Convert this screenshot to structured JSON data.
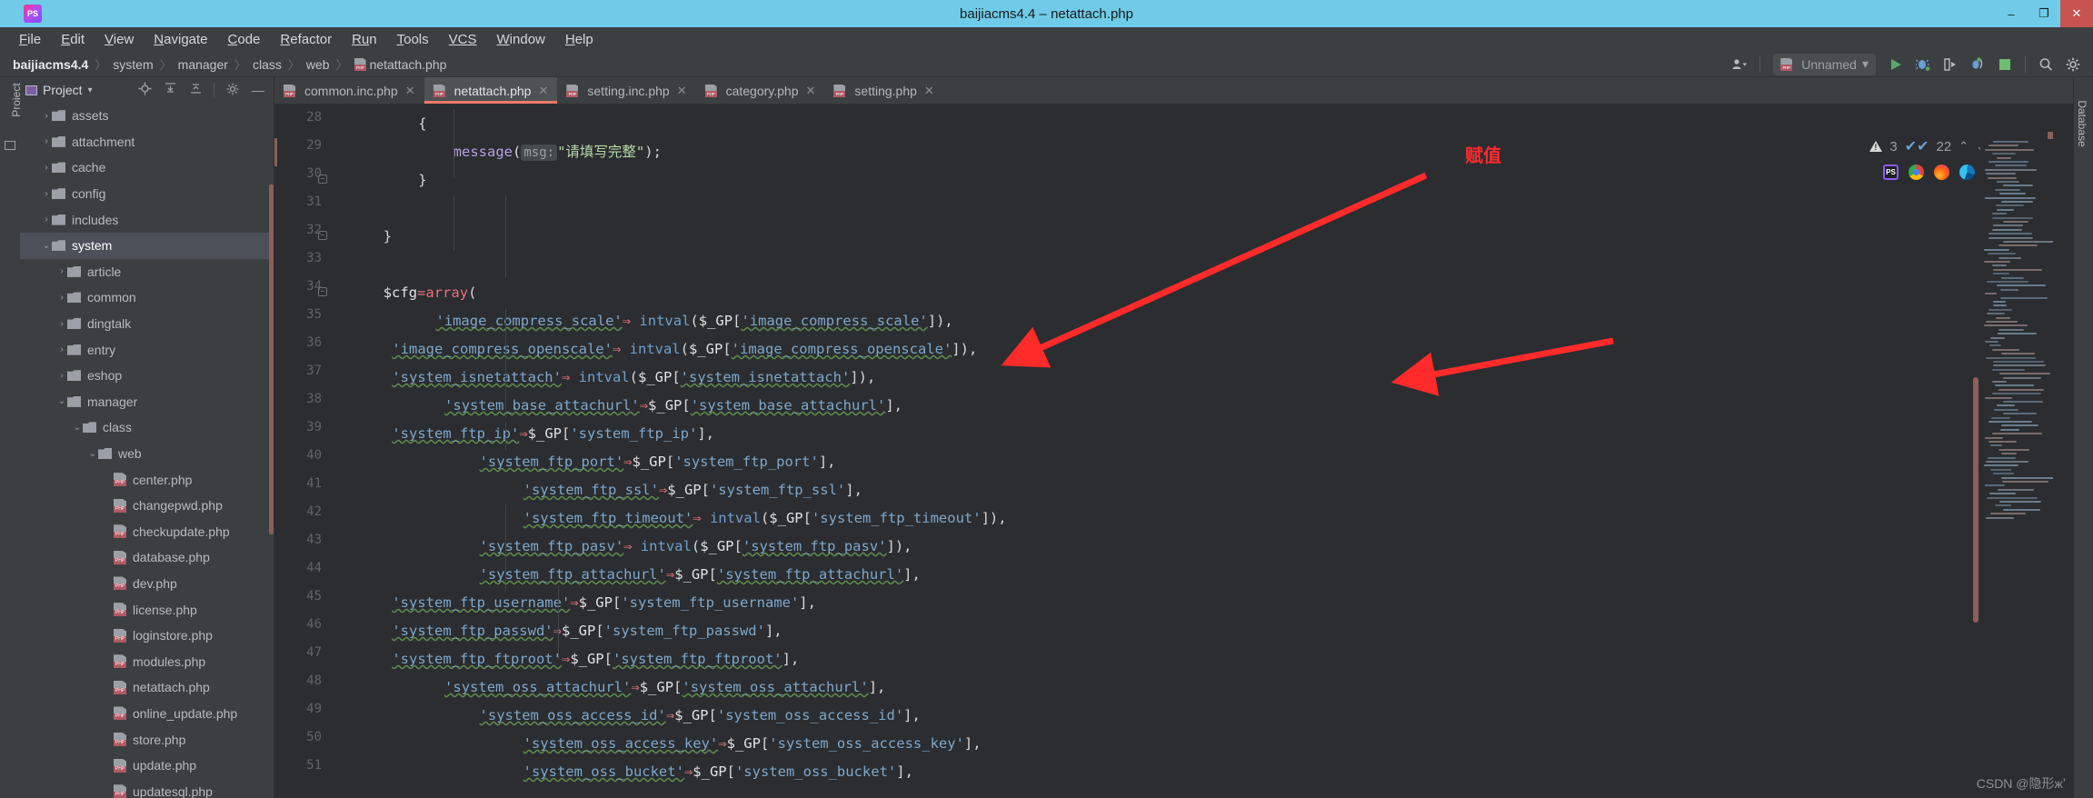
{
  "window": {
    "title": "baijiacms4.4 – netattach.php",
    "minimize": "–",
    "maximize": "❐",
    "close": "✕"
  },
  "menubar": {
    "items": [
      {
        "mnemonic": "F",
        "rest": "ile"
      },
      {
        "mnemonic": "E",
        "rest": "dit"
      },
      {
        "mnemonic": "V",
        "rest": "iew"
      },
      {
        "mnemonic": "N",
        "rest": "avigate"
      },
      {
        "mnemonic": "C",
        "rest": "ode"
      },
      {
        "mnemonic": "R",
        "rest": "efactor"
      },
      {
        "mnemonic": "Ru",
        "rest": "n"
      },
      {
        "mnemonic": "T",
        "rest": "ools"
      },
      {
        "mnemonic": "VCS",
        "rest": ""
      },
      {
        "mnemonic": "W",
        "rest": "indow"
      },
      {
        "mnemonic": "H",
        "rest": "elp"
      }
    ]
  },
  "breadcrumb": {
    "project": "baijiacms4.4",
    "separator": "〉",
    "path": [
      "system",
      "manager",
      "class",
      "web"
    ],
    "file": "netattach.php",
    "file_icon": "php-file-icon"
  },
  "toolbar": {
    "avatar_icon": "user-accounts-icon",
    "avatar_caret": "▾",
    "run_config": "Unnamed",
    "run_config_caret": "▾",
    "run_icon": "run-play-icon",
    "debug_icon": "debug-bug-icon",
    "run_coverage_icon": "run-with-coverage-icon",
    "profile_icon": "profile-icon",
    "stop_icon": "stop-square-icon",
    "search_icon": "search-icon",
    "settings_icon": "settings-gear-icon"
  },
  "left_strip": {
    "project_tab": "Project",
    "structure_icon": "project-panel-icon"
  },
  "right_strip": {
    "database_tab": "Database"
  },
  "project_panel": {
    "title": "Project",
    "caret": "▾",
    "icons": [
      "locate-icon",
      "expand-all-icon",
      "collapse-all-icon",
      "settings-gear-icon",
      "hide-icon"
    ],
    "tree": [
      {
        "label": "assets",
        "depth": 1,
        "type": "folder",
        "arrow": "›",
        "selected": false
      },
      {
        "label": "attachment",
        "depth": 1,
        "type": "folder",
        "arrow": "›",
        "selected": false
      },
      {
        "label": "cache",
        "depth": 1,
        "type": "folder",
        "arrow": "›",
        "selected": false
      },
      {
        "label": "config",
        "depth": 1,
        "type": "folder",
        "arrow": "›",
        "selected": false
      },
      {
        "label": "includes",
        "depth": 1,
        "type": "folder",
        "arrow": "›",
        "selected": false
      },
      {
        "label": "system",
        "depth": 1,
        "type": "folder",
        "arrow": "⌄",
        "selected": true
      },
      {
        "label": "article",
        "depth": 2,
        "type": "folder",
        "arrow": "›",
        "selected": false
      },
      {
        "label": "common",
        "depth": 2,
        "type": "folder",
        "arrow": "›",
        "selected": false
      },
      {
        "label": "dingtalk",
        "depth": 2,
        "type": "folder",
        "arrow": "›",
        "selected": false
      },
      {
        "label": "entry",
        "depth": 2,
        "type": "folder",
        "arrow": "›",
        "selected": false
      },
      {
        "label": "eshop",
        "depth": 2,
        "type": "folder",
        "arrow": "›",
        "selected": false
      },
      {
        "label": "manager",
        "depth": 2,
        "type": "folder",
        "arrow": "⌄",
        "selected": false
      },
      {
        "label": "class",
        "depth": 3,
        "type": "folder",
        "arrow": "⌄",
        "selected": false
      },
      {
        "label": "web",
        "depth": 4,
        "type": "folder",
        "arrow": "⌄",
        "selected": false
      },
      {
        "label": "center.php",
        "depth": 5,
        "type": "php",
        "arrow": "",
        "selected": false
      },
      {
        "label": "changepwd.php",
        "depth": 5,
        "type": "php",
        "arrow": "",
        "selected": false
      },
      {
        "label": "checkupdate.php",
        "depth": 5,
        "type": "php",
        "arrow": "",
        "selected": false
      },
      {
        "label": "database.php",
        "depth": 5,
        "type": "php",
        "arrow": "",
        "selected": false
      },
      {
        "label": "dev.php",
        "depth": 5,
        "type": "php",
        "arrow": "",
        "selected": false
      },
      {
        "label": "license.php",
        "depth": 5,
        "type": "php",
        "arrow": "",
        "selected": false
      },
      {
        "label": "loginstore.php",
        "depth": 5,
        "type": "php",
        "arrow": "",
        "selected": false
      },
      {
        "label": "modules.php",
        "depth": 5,
        "type": "php",
        "arrow": "",
        "selected": false
      },
      {
        "label": "netattach.php",
        "depth": 5,
        "type": "php",
        "arrow": "",
        "selected": false
      },
      {
        "label": "online_update.php",
        "depth": 5,
        "type": "php",
        "arrow": "",
        "selected": false
      },
      {
        "label": "store.php",
        "depth": 5,
        "type": "php",
        "arrow": "",
        "selected": false
      },
      {
        "label": "update.php",
        "depth": 5,
        "type": "php",
        "arrow": "",
        "selected": false
      },
      {
        "label": "updatesql.php",
        "depth": 5,
        "type": "php",
        "arrow": "",
        "selected": false
      }
    ]
  },
  "editor_tabs": [
    {
      "label": "common.inc.php",
      "active": false,
      "close": "✕"
    },
    {
      "label": "netattach.php",
      "active": true,
      "close": "✕"
    },
    {
      "label": "setting.inc.php",
      "active": false,
      "close": "✕"
    },
    {
      "label": "category.php",
      "active": false,
      "close": "✕"
    },
    {
      "label": "setting.php",
      "active": false,
      "close": "✕"
    }
  ],
  "inspection": {
    "warning_count": "3",
    "typo_count": "22",
    "prev_icon": "⌃",
    "next_icon": "⌄"
  },
  "browsers": [
    {
      "name": "phpstorm-icon",
      "label": "PS"
    },
    {
      "name": "chrome-icon",
      "label": ""
    },
    {
      "name": "firefox-icon",
      "label": ""
    },
    {
      "name": "edge-icon",
      "label": ""
    }
  ],
  "annotation": {
    "text": "赋值",
    "color": "#ff2a2a"
  },
  "watermark": "CSDN @隐形жʼ",
  "code": {
    "first_line_number": 28,
    "lines": [
      {
        "n": 28,
        "indent": 10,
        "fold": "",
        "err": false,
        "tokens": [
          {
            "t": "{",
            "c": "k-pun"
          }
        ]
      },
      {
        "n": 29,
        "indent": 14,
        "fold": "",
        "err": true,
        "tokens": [
          {
            "t": "message",
            "c": "k-fn"
          },
          {
            "t": "(",
            "c": "k-pun"
          },
          {
            "t": "msg:",
            "c": "hint"
          },
          {
            "t": "\"请填写完整\"",
            "c": "k-cjk"
          },
          {
            "t": ");",
            "c": "k-pun"
          }
        ]
      },
      {
        "n": 30,
        "indent": 10,
        "fold": "−",
        "err": false,
        "tokens": [
          {
            "t": "}",
            "c": "k-pun"
          }
        ]
      },
      {
        "n": 31,
        "indent": 0,
        "fold": "",
        "err": false,
        "tokens": []
      },
      {
        "n": 32,
        "indent": 6,
        "fold": "−",
        "err": false,
        "tokens": [
          {
            "t": "}",
            "c": "k-pun"
          }
        ]
      },
      {
        "n": 33,
        "indent": 0,
        "fold": "",
        "err": false,
        "tokens": []
      },
      {
        "n": 34,
        "indent": 6,
        "fold": "−",
        "err": false,
        "tokens": [
          {
            "t": "$cfg",
            "c": "k-var"
          },
          {
            "t": "=",
            "c": "k-arrow"
          },
          {
            "t": "array",
            "c": "k-arrow"
          },
          {
            "t": "(",
            "c": "k-pun"
          }
        ]
      },
      {
        "n": 35,
        "indent": 12,
        "fold": "",
        "err": false,
        "tokens": [
          {
            "t": "'image_compress_scale'",
            "c": "k-str squig"
          },
          {
            "t": "⇒",
            "c": "k-arrow"
          },
          {
            "t": " intval",
            "c": "k-intv"
          },
          {
            "t": "(",
            "c": "k-pun"
          },
          {
            "t": "$_GP",
            "c": "k-var"
          },
          {
            "t": "[",
            "c": "k-pun"
          },
          {
            "t": "'image_compress_scale'",
            "c": "k-str squig"
          },
          {
            "t": "]),",
            "c": "k-pun"
          }
        ]
      },
      {
        "n": 36,
        "indent": 7,
        "fold": "",
        "err": false,
        "tokens": [
          {
            "t": "'image_compress_openscale'",
            "c": "k-str squig"
          },
          {
            "t": "⇒",
            "c": "k-arrow"
          },
          {
            "t": " intval",
            "c": "k-intv"
          },
          {
            "t": "(",
            "c": "k-pun"
          },
          {
            "t": "$_GP",
            "c": "k-var"
          },
          {
            "t": "[",
            "c": "k-pun"
          },
          {
            "t": "'image_compress_openscale'",
            "c": "k-str squig"
          },
          {
            "t": "]),",
            "c": "k-pun"
          }
        ]
      },
      {
        "n": 37,
        "indent": 7,
        "fold": "",
        "err": false,
        "tokens": [
          {
            "t": "'system_isnetattach'",
            "c": "k-str squig"
          },
          {
            "t": "⇒",
            "c": "k-arrow"
          },
          {
            "t": " intval",
            "c": "k-intv"
          },
          {
            "t": "(",
            "c": "k-pun"
          },
          {
            "t": "$_GP",
            "c": "k-var"
          },
          {
            "t": "[",
            "c": "k-pun"
          },
          {
            "t": "'system_isnetattach'",
            "c": "k-str squig"
          },
          {
            "t": "]),",
            "c": "k-pun"
          }
        ]
      },
      {
        "n": 38,
        "indent": 13,
        "fold": "",
        "err": false,
        "tokens": [
          {
            "t": "'system_base_attachurl'",
            "c": "k-str squig"
          },
          {
            "t": "⇒",
            "c": "k-arrow"
          },
          {
            "t": "$_GP",
            "c": "k-var"
          },
          {
            "t": "[",
            "c": "k-pun"
          },
          {
            "t": "'system_base_attachurl'",
            "c": "k-str squig"
          },
          {
            "t": "],",
            "c": "k-pun"
          }
        ]
      },
      {
        "n": 39,
        "indent": 7,
        "fold": "",
        "err": false,
        "tokens": [
          {
            "t": "'system_ftp_ip'",
            "c": "k-str squig"
          },
          {
            "t": "⇒",
            "c": "k-arrow"
          },
          {
            "t": "$_GP",
            "c": "k-var"
          },
          {
            "t": "[",
            "c": "k-pun"
          },
          {
            "t": "'system_ftp_ip'",
            "c": "k-str"
          },
          {
            "t": "],",
            "c": "k-pun"
          }
        ]
      },
      {
        "n": 40,
        "indent": 17,
        "fold": "",
        "err": false,
        "tokens": [
          {
            "t": "'system_ftp_port'",
            "c": "k-str squig"
          },
          {
            "t": "⇒",
            "c": "k-arrow"
          },
          {
            "t": "$_GP",
            "c": "k-var"
          },
          {
            "t": "[",
            "c": "k-pun"
          },
          {
            "t": "'system_ftp_port'",
            "c": "k-str"
          },
          {
            "t": "],",
            "c": "k-pun"
          }
        ]
      },
      {
        "n": 41,
        "indent": 22,
        "fold": "",
        "err": false,
        "tokens": [
          {
            "t": "'system_ftp_ssl'",
            "c": "k-str squig"
          },
          {
            "t": "⇒",
            "c": "k-arrow"
          },
          {
            "t": "$_GP",
            "c": "k-var"
          },
          {
            "t": "[",
            "c": "k-pun"
          },
          {
            "t": "'system_ftp_ssl'",
            "c": "k-str"
          },
          {
            "t": "],",
            "c": "k-pun"
          }
        ]
      },
      {
        "n": 42,
        "indent": 22,
        "fold": "",
        "err": false,
        "tokens": [
          {
            "t": "'system_ftp_timeout'",
            "c": "k-str squig"
          },
          {
            "t": "⇒",
            "c": "k-arrow"
          },
          {
            "t": " intval",
            "c": "k-intv"
          },
          {
            "t": "(",
            "c": "k-pun"
          },
          {
            "t": "$_GP",
            "c": "k-var"
          },
          {
            "t": "[",
            "c": "k-pun"
          },
          {
            "t": "'system_ftp_timeout'",
            "c": "k-str"
          },
          {
            "t": "]),",
            "c": "k-pun"
          }
        ]
      },
      {
        "n": 43,
        "indent": 17,
        "fold": "",
        "err": false,
        "tokens": [
          {
            "t": "'system_ftp_pasv'",
            "c": "k-str squig"
          },
          {
            "t": "⇒",
            "c": "k-arrow"
          },
          {
            "t": " intval",
            "c": "k-intv"
          },
          {
            "t": "(",
            "c": "k-pun"
          },
          {
            "t": "$_GP",
            "c": "k-var"
          },
          {
            "t": "[",
            "c": "k-pun"
          },
          {
            "t": "'system_ftp_pasv'",
            "c": "k-str squig"
          },
          {
            "t": "]),",
            "c": "k-pun"
          }
        ]
      },
      {
        "n": 44,
        "indent": 17,
        "fold": "",
        "err": false,
        "tokens": [
          {
            "t": "'system_ftp_attachurl'",
            "c": "k-str squig"
          },
          {
            "t": "⇒",
            "c": "k-arrow"
          },
          {
            "t": "$_GP",
            "c": "k-var"
          },
          {
            "t": "[",
            "c": "k-pun"
          },
          {
            "t": "'system_ftp_attachurl'",
            "c": "k-str squig"
          },
          {
            "t": "],",
            "c": "k-pun"
          }
        ]
      },
      {
        "n": 45,
        "indent": 7,
        "fold": "",
        "err": false,
        "tokens": [
          {
            "t": "'system_ftp_username'",
            "c": "k-str squig"
          },
          {
            "t": "⇒",
            "c": "k-arrow"
          },
          {
            "t": "$_GP",
            "c": "k-var"
          },
          {
            "t": "[",
            "c": "k-pun"
          },
          {
            "t": "'system_ftp_username'",
            "c": "k-str"
          },
          {
            "t": "],",
            "c": "k-pun"
          }
        ]
      },
      {
        "n": 46,
        "indent": 7,
        "fold": "",
        "err": false,
        "tokens": [
          {
            "t": "'system_ftp_passwd'",
            "c": "k-str squig"
          },
          {
            "t": "⇒",
            "c": "k-arrow"
          },
          {
            "t": "$_GP",
            "c": "k-var"
          },
          {
            "t": "[",
            "c": "k-pun"
          },
          {
            "t": "'system_ftp_passwd'",
            "c": "k-str"
          },
          {
            "t": "],",
            "c": "k-pun"
          }
        ]
      },
      {
        "n": 47,
        "indent": 7,
        "fold": "",
        "err": false,
        "tokens": [
          {
            "t": "'system_ftp_ftproot'",
            "c": "k-str squig"
          },
          {
            "t": "⇒",
            "c": "k-arrow"
          },
          {
            "t": "$_GP",
            "c": "k-var"
          },
          {
            "t": "[",
            "c": "k-pun"
          },
          {
            "t": "'system_ftp_ftproot'",
            "c": "k-str squig"
          },
          {
            "t": "],",
            "c": "k-pun"
          }
        ]
      },
      {
        "n": 48,
        "indent": 13,
        "fold": "",
        "err": false,
        "tokens": [
          {
            "t": "'system_oss_attachurl'",
            "c": "k-str squig"
          },
          {
            "t": "⇒",
            "c": "k-arrow"
          },
          {
            "t": "$_GP",
            "c": "k-var"
          },
          {
            "t": "[",
            "c": "k-pun"
          },
          {
            "t": "'system_oss_attachurl'",
            "c": "k-str squig"
          },
          {
            "t": "],",
            "c": "k-pun"
          }
        ]
      },
      {
        "n": 49,
        "indent": 17,
        "fold": "",
        "err": false,
        "tokens": [
          {
            "t": "'system_oss_access_id'",
            "c": "k-str squig"
          },
          {
            "t": "⇒",
            "c": "k-arrow"
          },
          {
            "t": "$_GP",
            "c": "k-var"
          },
          {
            "t": "[",
            "c": "k-pun"
          },
          {
            "t": "'system_oss_access_id'",
            "c": "k-str"
          },
          {
            "t": "],",
            "c": "k-pun"
          }
        ]
      },
      {
        "n": 50,
        "indent": 22,
        "fold": "",
        "err": false,
        "tokens": [
          {
            "t": "'system_oss_access_key'",
            "c": "k-str squig"
          },
          {
            "t": "⇒",
            "c": "k-arrow"
          },
          {
            "t": "$_GP",
            "c": "k-var"
          },
          {
            "t": "[",
            "c": "k-pun"
          },
          {
            "t": "'system_oss_access_key'",
            "c": "k-str"
          },
          {
            "t": "],",
            "c": "k-pun"
          }
        ]
      },
      {
        "n": 51,
        "indent": 22,
        "fold": "",
        "err": false,
        "tokens": [
          {
            "t": "'system_oss_bucket'",
            "c": "k-str squig"
          },
          {
            "t": "⇒",
            "c": "k-arrow"
          },
          {
            "t": "$_GP",
            "c": "k-var"
          },
          {
            "t": "[",
            "c": "k-pun"
          },
          {
            "t": "'system_oss_bucket'",
            "c": "k-str"
          },
          {
            "t": "],",
            "c": "k-pun"
          }
        ]
      }
    ]
  }
}
